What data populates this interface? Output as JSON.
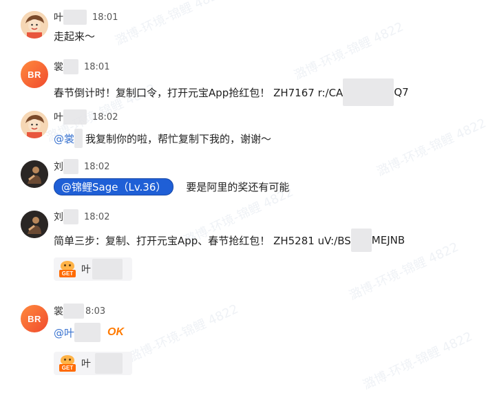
{
  "messages": [
    {
      "name": "叶",
      "time": "18:01",
      "text": "走起来～"
    },
    {
      "name": "裳",
      "avatar_text": "BR",
      "time": "18:01",
      "text": "春节倒计时！复制口令，打开元宝App抢红包！ ZH7167 r:/CA",
      "text_tail": "Q7"
    },
    {
      "name": "叶",
      "time": "18:02",
      "mention": "@裳",
      "text": "我复制你的啦，帮忙复制下我的，谢谢～"
    },
    {
      "name": "刘",
      "time": "18:02",
      "pill": "@锦鲤Sage（Lv.36）",
      "text": "要是阿里的奖还有可能"
    },
    {
      "name": "刘",
      "time": "18:02",
      "text": "简单三步：复制、打开元宝App、春节抢红包！ ZH5281 uV:/BS",
      "text_tail": "MEJNB",
      "card": {
        "label": "叶",
        "icon": "get-badge-icon",
        "badge": "GET"
      }
    },
    {
      "name": "裳",
      "avatar_text": "BR",
      "time": "8:03",
      "mention": "@叶",
      "sticker": "OK",
      "card": {
        "label": "叶",
        "icon": "get-badge-icon",
        "badge": "GET"
      }
    }
  ],
  "watermark": "潞博-环境-锦鲤 4822",
  "colors": {
    "mention": "#3872cf",
    "pill": "#1f5fd6",
    "avatar_br": "#f04a2e",
    "ok": "#ff7a00"
  }
}
